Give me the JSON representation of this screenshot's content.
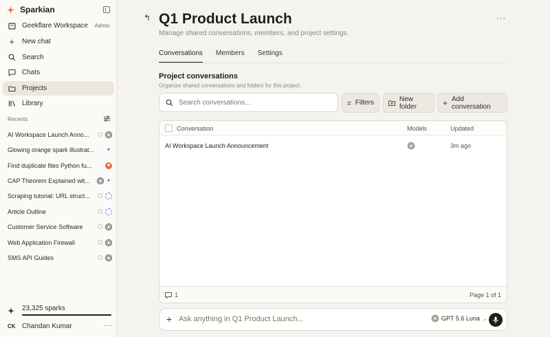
{
  "sidebar": {
    "brand": "Sparkian",
    "workspace": {
      "name": "Geekflare Workspace",
      "role": "Admin"
    },
    "nav": [
      {
        "label": "New chat",
        "icon": "plus-icon"
      },
      {
        "label": "Search",
        "icon": "search-icon"
      },
      {
        "label": "Chats",
        "icon": "chat-icon"
      },
      {
        "label": "Projects",
        "icon": "projects-icon",
        "active": true
      },
      {
        "label": "Library",
        "icon": "library-icon"
      }
    ],
    "recents_label": "Recents",
    "recents": [
      {
        "title": "AI Workspace Launch Anno...",
        "icons": [
          "cube-icon",
          "gpt-icon"
        ]
      },
      {
        "title": "Glowing orange spark illustrat...",
        "icons": [
          "gemini-icon"
        ]
      },
      {
        "title": "Find duplicate files Python fu...",
        "icons": [
          "claude-icon"
        ]
      },
      {
        "title": "CAP Theorem Explained wit...",
        "icons": [
          "gpt-icon",
          "gemini-icon"
        ]
      },
      {
        "title": "Scraping tutorial: URL struct...",
        "icons": [
          "cube-icon",
          "perplexity-icon"
        ]
      },
      {
        "title": "Article Outline",
        "icons": [
          "cube-icon",
          "perplexity-icon"
        ]
      },
      {
        "title": "Customer Service Software",
        "icons": [
          "cube-icon",
          "gpt-icon"
        ]
      },
      {
        "title": "Web Application Firewall",
        "icons": [
          "cube-icon",
          "gpt-icon"
        ]
      },
      {
        "title": "SMS API Guides",
        "icons": [
          "cube-icon",
          "gpt-icon"
        ]
      }
    ],
    "sparks": "23,325 sparks",
    "user": {
      "initials": "CK",
      "name": "Chandan Kumar"
    }
  },
  "page": {
    "title": "Q1 Product Launch",
    "subtitle": "Manage shared conversations, members, and project settings.",
    "tabs": [
      {
        "label": "Conversations",
        "active": true
      },
      {
        "label": "Members"
      },
      {
        "label": "Settings"
      }
    ],
    "section_title": "Project conversations",
    "section_subtitle": "Organize shared conversations and folders for this project.",
    "search_placeholder": "Search conversations...",
    "buttons": {
      "filters": "Filters",
      "new_folder": "New folder",
      "add_conversation": "Add conversation"
    },
    "table": {
      "columns": [
        "Conversation",
        "Models",
        "Updated"
      ],
      "rows": [
        {
          "conversation": "AI Workspace Launch Announcement",
          "models": [
            "gpt-icon"
          ],
          "updated": "3m ago"
        }
      ],
      "count": "1",
      "pagination": "Page 1 of 1"
    },
    "composer": {
      "placeholder": "Ask anything in Q1 Product Launch...",
      "model": "GPT 5.6 Luna"
    }
  },
  "colors": {
    "accent": "#e8613a",
    "active_nav_bg": "#ece7db",
    "main_bg": "#f5f3ee"
  }
}
